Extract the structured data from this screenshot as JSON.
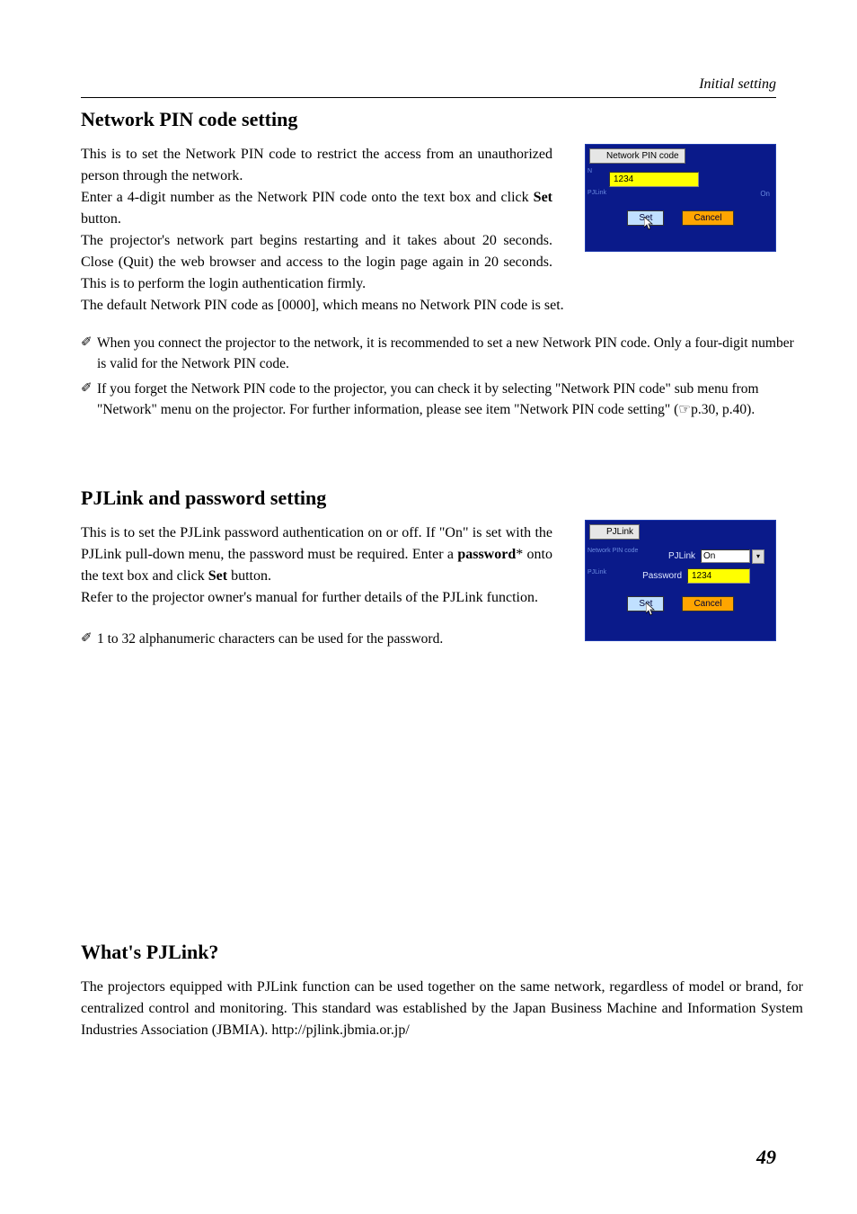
{
  "header": {
    "right": "Initial setting"
  },
  "section1": {
    "heading": "Network PIN code setting",
    "p1": "This is to set the Network PIN code to restrict the access from an unauthorized person through the network.",
    "p2a": "Enter a 4-digit number as the Network PIN code onto the text box and click ",
    "p2b": "Set",
    "p2c": " button.",
    "p3": "The projector's network part begins restarting and it takes about 20 seconds. Close (Quit) the web browser and access to the login page again in 20 seconds. This is to perform the login authentication firmly.",
    "p4": "The default Network PIN code as [0000], which means no Network PIN code is set.",
    "notes": [
      "When you connect the projector to the network, it is recommended to set a new Network PIN code. Only a four-digit number is valid for the Network PIN code.",
      "If you forget the Network PIN code to the projector, you can check it by selecting \"Network PIN code\" sub menu from \"Network\" menu on the projector. For further information, please see item \"Network PIN code setting\" (☞p.30, p.40)."
    ]
  },
  "section2": {
    "heading": "PJLink and password setting",
    "p1a": "This is to set the PJLink password authentication on or off. If \"On\" is set with the PJLink pull-down menu, the password must be required. Enter a ",
    "p1b": "password",
    "p1c": "* onto the text box and click ",
    "p1d": "Set",
    "p1e": " button.",
    "p2": "Refer to the projector owner's manual for further details of the PJLink function.",
    "notes": [
      "1 to 32 alphanumeric characters can be used for the password."
    ]
  },
  "section3": {
    "heading": "What's PJLink?",
    "p1": "The projectors equipped with PJLink function can be used together on the same network, regardless of model or brand, for centralized control and monitoring. This standard was established by the Japan Business Machine and Information System Industries Association (JBMIA). http://pjlink.jbmia.or.jp/"
  },
  "dialog_pin": {
    "title": "Network PIN code",
    "input_value": "1234",
    "left1": "N",
    "left2": "PJLink",
    "right1": "On",
    "set": "Set",
    "cancel": "Cancel"
  },
  "dialog_pjlink": {
    "title": "PJLink",
    "label_pjlink": "PJLink",
    "value_pjlink": "On",
    "label_password": "Password",
    "value_password": "1234",
    "left1": "Network PIN code",
    "left2": "PJLink",
    "set": "Set",
    "cancel": "Cancel"
  },
  "page_number": "49"
}
